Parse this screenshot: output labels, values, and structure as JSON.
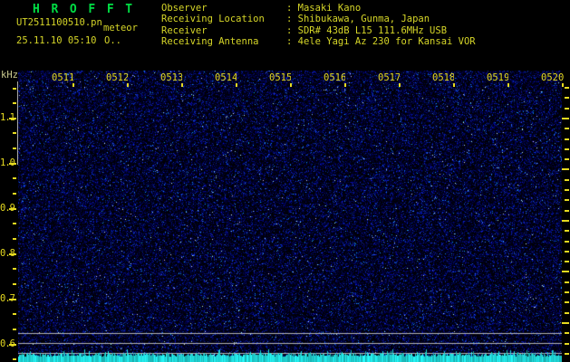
{
  "header": {
    "title": "H R O F F T",
    "filename": "UT2511100510.pn",
    "station": "meteor",
    "datetime": "25.11.10 05:10",
    "counter": "O..",
    "info": [
      {
        "label": "Observer",
        "value": "Masaki Kano"
      },
      {
        "label": "Receiving Location",
        "value": "Shibukawa, Gunma, Japan"
      },
      {
        "label": "Receiver",
        "value": "SDR# 43dB L15 111.6MHz USB"
      },
      {
        "label": "Receiving Antenna",
        "value": "4ele Yagi Az 230 for Kansai VOR"
      }
    ]
  },
  "chart": {
    "unit_label": "kHz",
    "time_labels": [
      "0511",
      "0512",
      "0513",
      "0514",
      "0515",
      "0516",
      "0517",
      "0518",
      "0519",
      "0520"
    ],
    "freq_labels": [
      "1.1",
      "1.0",
      "0.9",
      "0.8",
      "0.7",
      "0.6"
    ]
  },
  "chart_data": {
    "type": "heatmap",
    "title": "HROFFT 10-minute radio meteor echo spectrogram",
    "date_utc": "25.11.10",
    "start_time_utc": "05:10",
    "x_tick_labels": [
      "0511",
      "0512",
      "0513",
      "0514",
      "0515",
      "0516",
      "0517",
      "0518",
      "0519",
      "0520"
    ],
    "x_minutes_per_division": 1,
    "ylabel": "kHz",
    "y_tick_labels": [
      1.1,
      1.0,
      0.9,
      0.8,
      0.7,
      0.6
    ],
    "ylim": [
      0.56,
      1.2
    ],
    "content": "uniform dark-blue random background noise across the whole field; no strong meteor echo traces visible",
    "bottom_trace": "cyan jagged signal-level time series along the bottom edge of the plot",
    "reference_lines": "three horizontal gray level lines near the bottom of the plot",
    "legend": "none",
    "grid": "off"
  },
  "colors": {
    "background": "#000000",
    "title_green": "#00dd44",
    "text_yellow": "#d6d628",
    "tick_yellow": "#e6da20",
    "unit_label": "#cccc90",
    "gray_line": "#b4b4b4",
    "signal_cyan": "#00e0e0",
    "noise_blue": "#2233bb"
  }
}
